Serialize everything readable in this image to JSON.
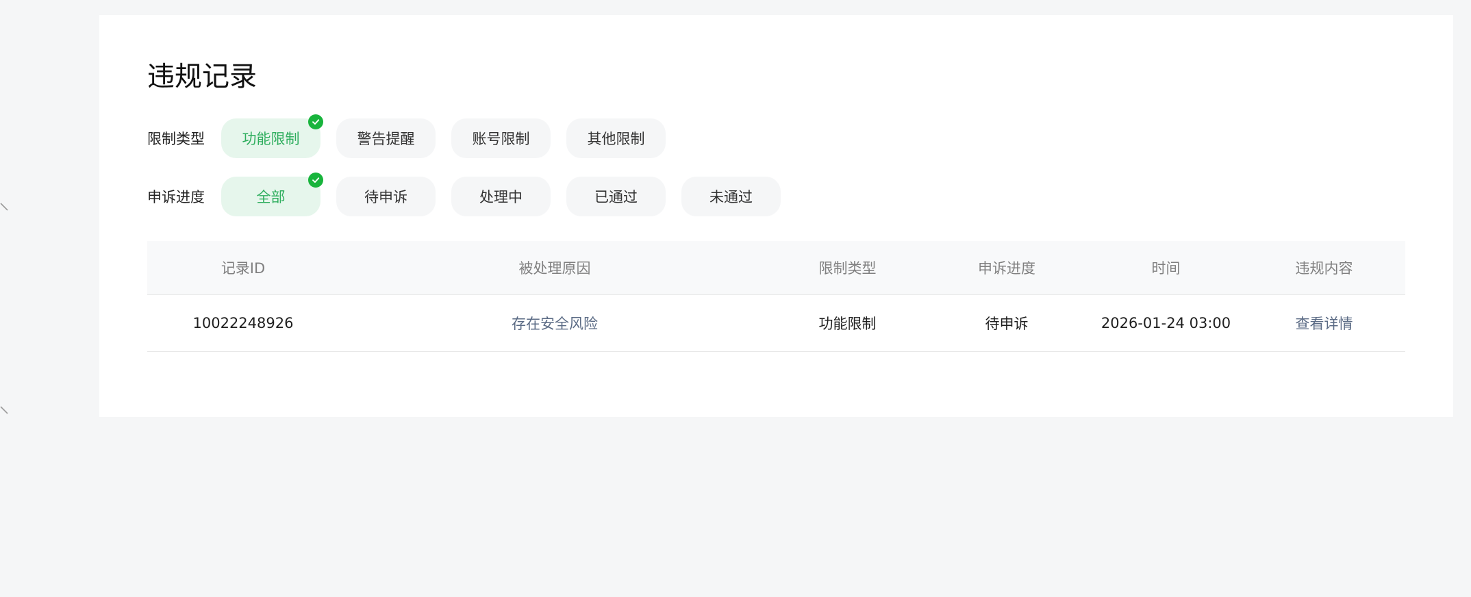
{
  "page_title": "违规记录",
  "filters": {
    "restriction": {
      "label": "限制类型",
      "options": [
        "功能限制",
        "警告提醒",
        "账号限制",
        "其他限制"
      ],
      "selected": "功能限制"
    },
    "appeal": {
      "label": "申诉进度",
      "options": [
        "全部",
        "待申诉",
        "处理中",
        "已通过",
        "未通过"
      ],
      "selected": "全部"
    }
  },
  "table": {
    "headers": [
      "记录ID",
      "被处理原因",
      "限制类型",
      "申诉进度",
      "时间",
      "违规内容"
    ],
    "rows": [
      {
        "record_id": "10022248926",
        "reason": "存在安全风险",
        "restriction_type": "功能限制",
        "appeal_status": "待申诉",
        "time": "2026-01-24 03:00",
        "content_link": "查看详情"
      }
    ]
  },
  "colors": {
    "accent_green": "#18b43c",
    "active_chip_bg": "#e6f6ec",
    "active_chip_text": "#2fae5e",
    "link": "#5b6b85"
  },
  "icons": {
    "selected_check": "check-circle-icon",
    "side_arrow": "chevron-left-icon"
  }
}
